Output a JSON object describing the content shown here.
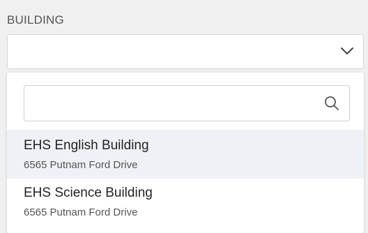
{
  "field": {
    "label": "BUILDING",
    "selected_value": ""
  },
  "dropdown": {
    "search_value": "",
    "icons": {
      "chevron": "chevron-down-icon",
      "search": "search-icon"
    },
    "options": [
      {
        "name": "EHS English Building",
        "address": "6565 Putnam Ford Drive",
        "highlighted": true
      },
      {
        "name": "EHS Science Building",
        "address": "6565 Putnam Ford Drive",
        "highlighted": false
      }
    ]
  },
  "colors": {
    "highlight": "#eef1f5",
    "border": "#d6d6d6",
    "background": "#f0f0f0"
  }
}
